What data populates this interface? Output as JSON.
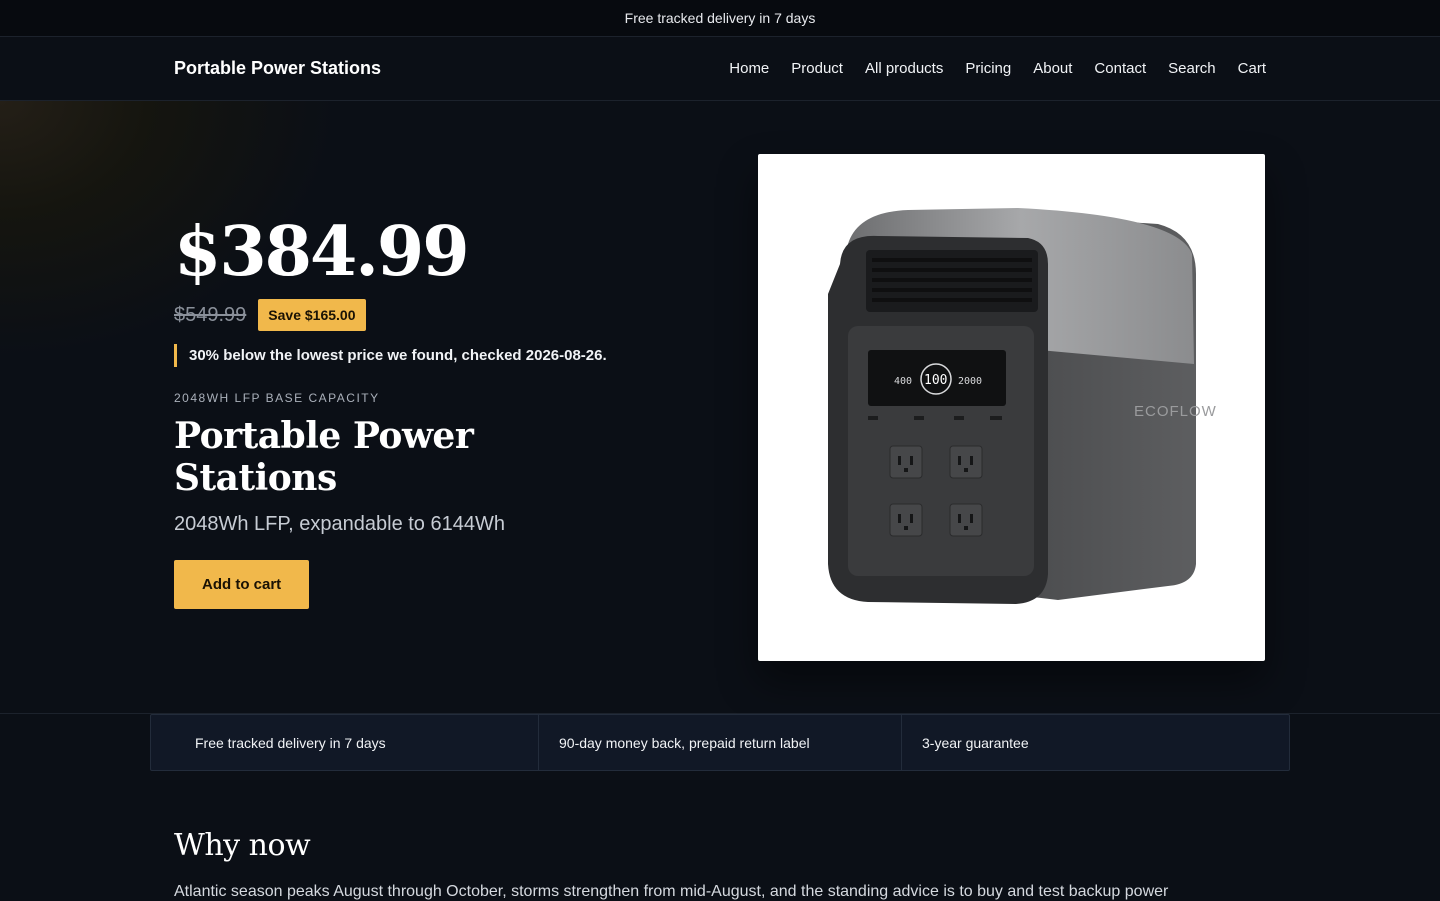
{
  "announcement": "Free tracked delivery in 7 days",
  "header": {
    "brand": "Portable Power Stations",
    "nav": [
      "Home",
      "Product",
      "All products",
      "Pricing",
      "About",
      "Contact",
      "Search",
      "Cart"
    ]
  },
  "hero": {
    "price": "$384.99",
    "old_price": "$549.99",
    "save_badge": "Save $165.00",
    "note": "30% below the lowest price we found, checked 2026-08-26.",
    "eyebrow": "2048WH LFP BASE CAPACITY",
    "title": "Portable Power Stations",
    "subtitle": "2048Wh LFP, expandable to 6144Wh",
    "cta": "Add to cart",
    "product_image": {
      "brand_mark": "ECOFLOW",
      "display_values": [
        "400",
        "100",
        "2000"
      ]
    }
  },
  "benefits": [
    "Free tracked delivery in 7 days",
    "90-day money back, prepaid return label",
    "3-year guarantee"
  ],
  "why": {
    "heading": "Why now",
    "body": "Atlantic season peaks August through October, storms strengthen from mid-August, and the standing advice is to buy and test backup power"
  },
  "colors": {
    "accent": "#f1b84b",
    "background": "#0b0f16",
    "card": "#111826"
  }
}
